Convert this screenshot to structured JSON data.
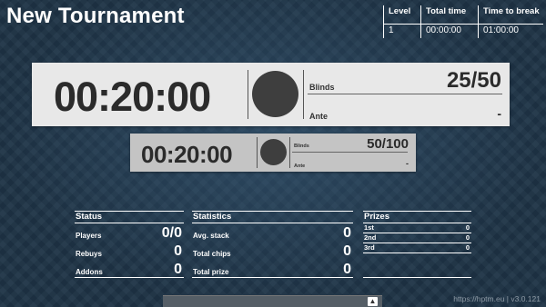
{
  "title": "New Tournament",
  "info": {
    "level": {
      "label": "Level",
      "value": "1"
    },
    "total_time": {
      "label": "Total time",
      "value": "00:00:00"
    },
    "time_to_break": {
      "label": "Time to break",
      "value": "01:00:00"
    }
  },
  "current": {
    "timer": "00:20:00",
    "blinds_label": "Blinds",
    "blinds_value": "25/50",
    "ante_label": "Ante",
    "ante_value": "-"
  },
  "next": {
    "timer": "00:20:00",
    "blinds_label": "Blinds",
    "blinds_value": "50/100",
    "ante_label": "Ante",
    "ante_value": "-"
  },
  "status": {
    "header": "Status",
    "rows": [
      {
        "label": "Players",
        "value": "0/0"
      },
      {
        "label": "Rebuys",
        "value": "0"
      },
      {
        "label": "Addons",
        "value": "0"
      }
    ]
  },
  "statistics": {
    "header": "Statistics",
    "rows": [
      {
        "label": "Avg. stack",
        "value": "0"
      },
      {
        "label": "Total chips",
        "value": "0"
      },
      {
        "label": "Total prize",
        "value": "0"
      }
    ]
  },
  "prizes": {
    "header": "Prizes",
    "rows": [
      {
        "label": "1st",
        "value": "0"
      },
      {
        "label": "2nd",
        "value": "0"
      },
      {
        "label": "3rd",
        "value": "0"
      }
    ]
  },
  "scroll_icon": "arrow-up-icon",
  "footer": "https://hptm.eu | v3.0.121"
}
